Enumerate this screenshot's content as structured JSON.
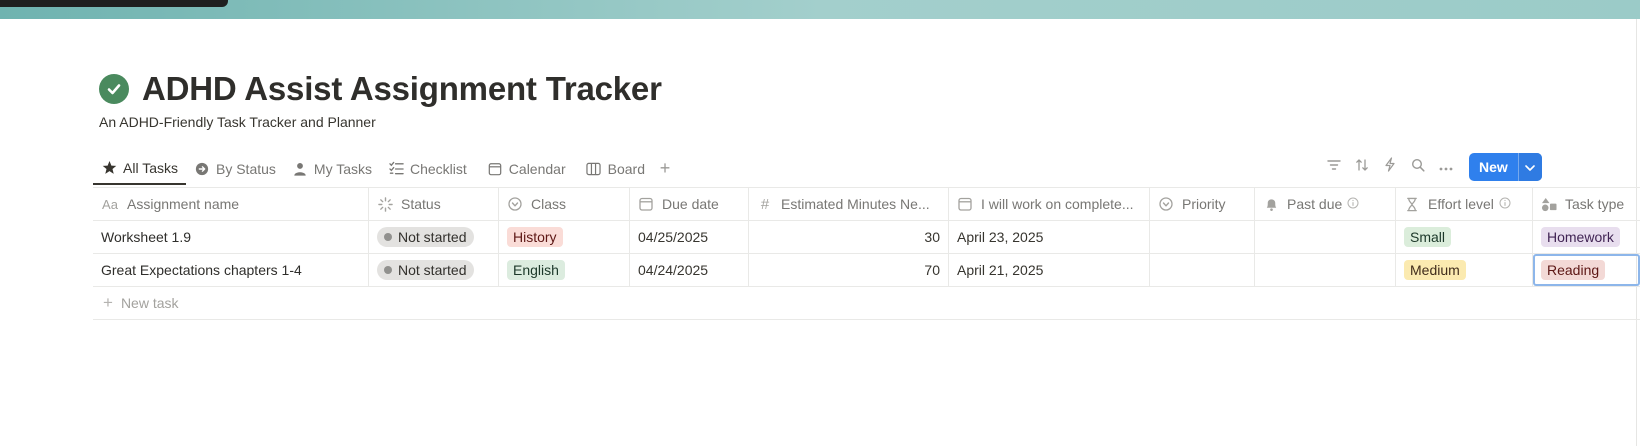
{
  "page": {
    "title": "ADHD Assist Assignment Tracker",
    "subtitle": "An ADHD-Friendly Task Tracker and Planner",
    "icon": "check-circle-icon"
  },
  "tabs": [
    {
      "label": "All Tasks",
      "icon": "star-icon",
      "active": true
    },
    {
      "label": "By Status",
      "icon": "arrow-circle-icon",
      "active": false
    },
    {
      "label": "My Tasks",
      "icon": "person-icon",
      "active": false
    },
    {
      "label": "Checklist",
      "icon": "checklist-icon",
      "active": false
    },
    {
      "label": "Calendar",
      "icon": "calendar-icon",
      "active": false
    },
    {
      "label": "Board",
      "icon": "board-icon",
      "active": false
    }
  ],
  "toolbar": {
    "new_label": "New",
    "icons": [
      "filter-icon",
      "sort-icon",
      "automation-icon",
      "search-icon",
      "more-icon"
    ]
  },
  "columns": [
    {
      "label": "Assignment name",
      "icon": "text-icon",
      "icon_glyph": "Aa"
    },
    {
      "label": "Status",
      "icon": "status-icon"
    },
    {
      "label": "Class",
      "icon": "select-icon"
    },
    {
      "label": "Due date",
      "icon": "date-icon"
    },
    {
      "label": "Estimated Minutes Ne...",
      "icon": "number-icon",
      "icon_glyph": "#"
    },
    {
      "label": "I will work on complete...",
      "icon": "date-icon"
    },
    {
      "label": "Priority",
      "icon": "select-icon"
    },
    {
      "label": "Past due",
      "icon": "formula-icon",
      "info": true
    },
    {
      "label": "Effort level",
      "icon": "formula-icon",
      "info": true
    },
    {
      "label": "Task type",
      "icon": "shapes-icon"
    }
  ],
  "rows": [
    {
      "name": "Worksheet 1.9",
      "status": "Not started",
      "class": "History",
      "due_date": "04/25/2025",
      "minutes": "30",
      "work_on": "April 23, 2025",
      "priority": "",
      "past_due": "",
      "effort": "Small",
      "task_type": "Homework"
    },
    {
      "name": "Great Expectations chapters 1-4",
      "status": "Not started",
      "class": "English",
      "due_date": "04/24/2025",
      "minutes": "70",
      "work_on": "April 21, 2025",
      "priority": "",
      "past_due": "",
      "effort": "Medium",
      "task_type": "Reading"
    }
  ],
  "new_task_label": "New task",
  "colors": {
    "accent": "#2f80ed",
    "title_icon": "#4a8a5e",
    "history_bg": "#fadcd7",
    "history_fg": "#5d1715",
    "english_bg": "#dcecdf",
    "english_fg": "#1c3829",
    "small_bg": "#dbeddb",
    "small_fg": "#1c3829",
    "medium_bg": "#fbeab0",
    "medium_fg": "#402c1b",
    "homework_bg": "#e8deee",
    "homework_fg": "#412454",
    "reading_bg": "#f3d9d6",
    "reading_fg": "#5d1715"
  }
}
